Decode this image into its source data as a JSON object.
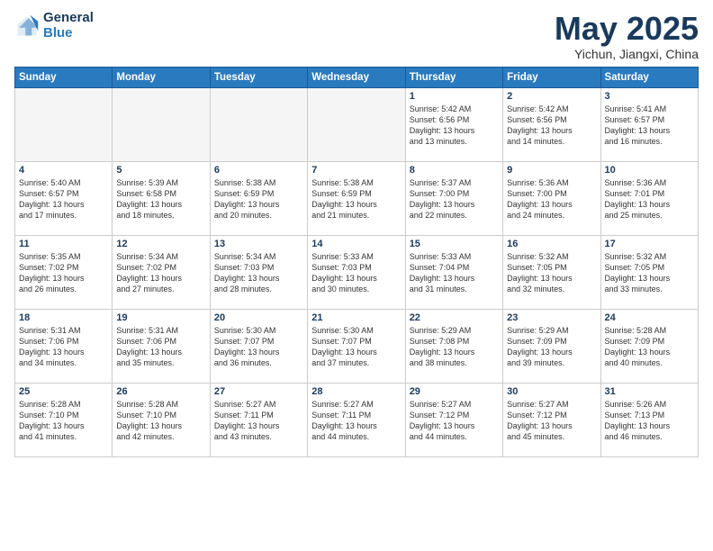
{
  "logo": {
    "line1": "General",
    "line2": "Blue"
  },
  "title": "May 2025",
  "subtitle": "Yichun, Jiangxi, China",
  "weekdays": [
    "Sunday",
    "Monday",
    "Tuesday",
    "Wednesday",
    "Thursday",
    "Friday",
    "Saturday"
  ],
  "weeks": [
    [
      {
        "day": "",
        "info": ""
      },
      {
        "day": "",
        "info": ""
      },
      {
        "day": "",
        "info": ""
      },
      {
        "day": "",
        "info": ""
      },
      {
        "day": "1",
        "info": "Sunrise: 5:42 AM\nSunset: 6:56 PM\nDaylight: 13 hours\nand 13 minutes."
      },
      {
        "day": "2",
        "info": "Sunrise: 5:42 AM\nSunset: 6:56 PM\nDaylight: 13 hours\nand 14 minutes."
      },
      {
        "day": "3",
        "info": "Sunrise: 5:41 AM\nSunset: 6:57 PM\nDaylight: 13 hours\nand 16 minutes."
      }
    ],
    [
      {
        "day": "4",
        "info": "Sunrise: 5:40 AM\nSunset: 6:57 PM\nDaylight: 13 hours\nand 17 minutes."
      },
      {
        "day": "5",
        "info": "Sunrise: 5:39 AM\nSunset: 6:58 PM\nDaylight: 13 hours\nand 18 minutes."
      },
      {
        "day": "6",
        "info": "Sunrise: 5:38 AM\nSunset: 6:59 PM\nDaylight: 13 hours\nand 20 minutes."
      },
      {
        "day": "7",
        "info": "Sunrise: 5:38 AM\nSunset: 6:59 PM\nDaylight: 13 hours\nand 21 minutes."
      },
      {
        "day": "8",
        "info": "Sunrise: 5:37 AM\nSunset: 7:00 PM\nDaylight: 13 hours\nand 22 minutes."
      },
      {
        "day": "9",
        "info": "Sunrise: 5:36 AM\nSunset: 7:00 PM\nDaylight: 13 hours\nand 24 minutes."
      },
      {
        "day": "10",
        "info": "Sunrise: 5:36 AM\nSunset: 7:01 PM\nDaylight: 13 hours\nand 25 minutes."
      }
    ],
    [
      {
        "day": "11",
        "info": "Sunrise: 5:35 AM\nSunset: 7:02 PM\nDaylight: 13 hours\nand 26 minutes."
      },
      {
        "day": "12",
        "info": "Sunrise: 5:34 AM\nSunset: 7:02 PM\nDaylight: 13 hours\nand 27 minutes."
      },
      {
        "day": "13",
        "info": "Sunrise: 5:34 AM\nSunset: 7:03 PM\nDaylight: 13 hours\nand 28 minutes."
      },
      {
        "day": "14",
        "info": "Sunrise: 5:33 AM\nSunset: 7:03 PM\nDaylight: 13 hours\nand 30 minutes."
      },
      {
        "day": "15",
        "info": "Sunrise: 5:33 AM\nSunset: 7:04 PM\nDaylight: 13 hours\nand 31 minutes."
      },
      {
        "day": "16",
        "info": "Sunrise: 5:32 AM\nSunset: 7:05 PM\nDaylight: 13 hours\nand 32 minutes."
      },
      {
        "day": "17",
        "info": "Sunrise: 5:32 AM\nSunset: 7:05 PM\nDaylight: 13 hours\nand 33 minutes."
      }
    ],
    [
      {
        "day": "18",
        "info": "Sunrise: 5:31 AM\nSunset: 7:06 PM\nDaylight: 13 hours\nand 34 minutes."
      },
      {
        "day": "19",
        "info": "Sunrise: 5:31 AM\nSunset: 7:06 PM\nDaylight: 13 hours\nand 35 minutes."
      },
      {
        "day": "20",
        "info": "Sunrise: 5:30 AM\nSunset: 7:07 PM\nDaylight: 13 hours\nand 36 minutes."
      },
      {
        "day": "21",
        "info": "Sunrise: 5:30 AM\nSunset: 7:07 PM\nDaylight: 13 hours\nand 37 minutes."
      },
      {
        "day": "22",
        "info": "Sunrise: 5:29 AM\nSunset: 7:08 PM\nDaylight: 13 hours\nand 38 minutes."
      },
      {
        "day": "23",
        "info": "Sunrise: 5:29 AM\nSunset: 7:09 PM\nDaylight: 13 hours\nand 39 minutes."
      },
      {
        "day": "24",
        "info": "Sunrise: 5:28 AM\nSunset: 7:09 PM\nDaylight: 13 hours\nand 40 minutes."
      }
    ],
    [
      {
        "day": "25",
        "info": "Sunrise: 5:28 AM\nSunset: 7:10 PM\nDaylight: 13 hours\nand 41 minutes."
      },
      {
        "day": "26",
        "info": "Sunrise: 5:28 AM\nSunset: 7:10 PM\nDaylight: 13 hours\nand 42 minutes."
      },
      {
        "day": "27",
        "info": "Sunrise: 5:27 AM\nSunset: 7:11 PM\nDaylight: 13 hours\nand 43 minutes."
      },
      {
        "day": "28",
        "info": "Sunrise: 5:27 AM\nSunset: 7:11 PM\nDaylight: 13 hours\nand 44 minutes."
      },
      {
        "day": "29",
        "info": "Sunrise: 5:27 AM\nSunset: 7:12 PM\nDaylight: 13 hours\nand 44 minutes."
      },
      {
        "day": "30",
        "info": "Sunrise: 5:27 AM\nSunset: 7:12 PM\nDaylight: 13 hours\nand 45 minutes."
      },
      {
        "day": "31",
        "info": "Sunrise: 5:26 AM\nSunset: 7:13 PM\nDaylight: 13 hours\nand 46 minutes."
      }
    ]
  ]
}
